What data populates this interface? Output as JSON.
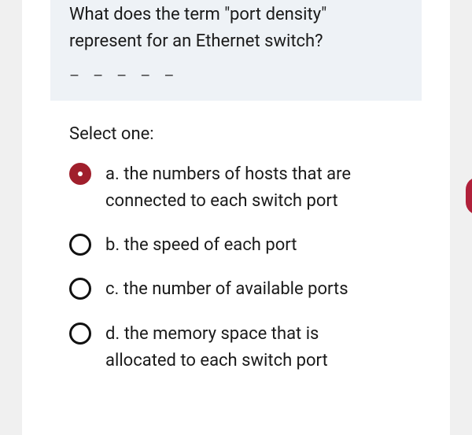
{
  "question": {
    "text": "What does the term \"port density\" represent for an Ethernet switch?",
    "dashes": "– – – – –"
  },
  "prompt": "Select one:",
  "options": [
    {
      "letter": "a.",
      "text": "the numbers of hosts that are connected to each switch port",
      "selected": true
    },
    {
      "letter": "b.",
      "text": "the speed of each port",
      "selected": false
    },
    {
      "letter": "c.",
      "text": "the number of available ports",
      "selected": false
    },
    {
      "letter": "d.",
      "text": "the memory space that is allocated to each switch port",
      "selected": false
    }
  ]
}
